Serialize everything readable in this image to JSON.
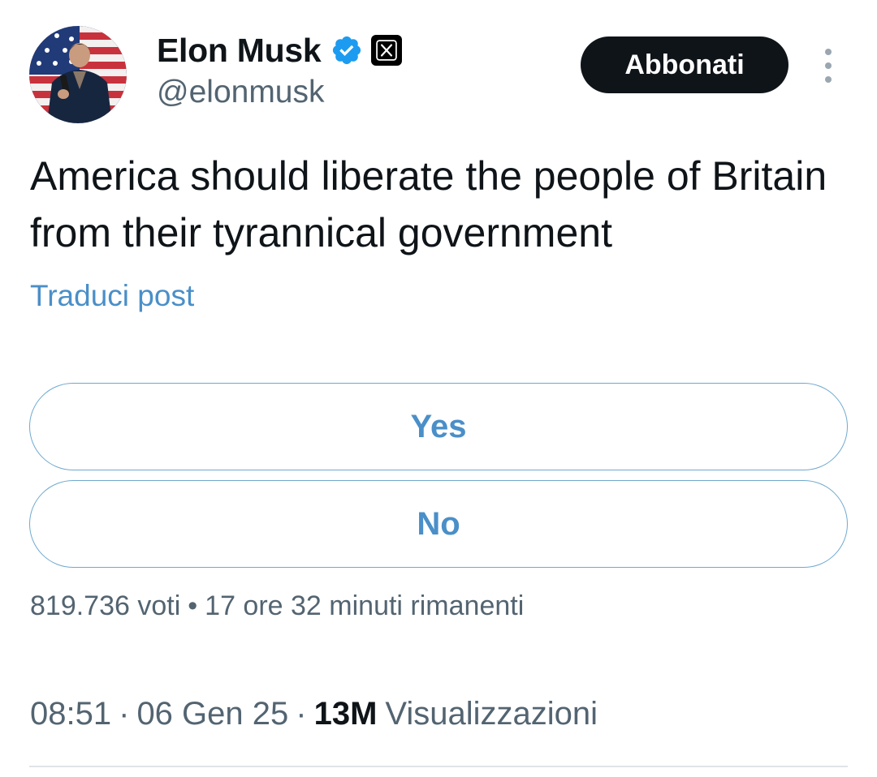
{
  "author": {
    "display_name": "Elon Musk",
    "handle": "@elonmusk",
    "verified": true
  },
  "subscribe_label": "Abbonati",
  "post": {
    "text": "America should liberate the people of Britain from their tyrannical government",
    "translate_label": "Traduci post"
  },
  "poll": {
    "options": [
      {
        "label": "Yes"
      },
      {
        "label": "No"
      }
    ],
    "votes": "819.736 voti",
    "separator": "•",
    "time_left": "17 ore 32 minuti rimanenti"
  },
  "meta": {
    "time": "08:51",
    "date": "06 Gen 25",
    "separator": "·",
    "views_count": "13M",
    "views_label": "Visualizzazioni"
  },
  "colors": {
    "accent": "#4a8fc8",
    "verified_badge": "#1d9bf0",
    "text_primary": "#0f1419",
    "text_secondary": "#536471",
    "button_dark": "#0f1419"
  },
  "icons": {
    "verified": "verified-badge-icon",
    "x_logo": "x-logo-icon",
    "more": "more-vertical-icon"
  }
}
